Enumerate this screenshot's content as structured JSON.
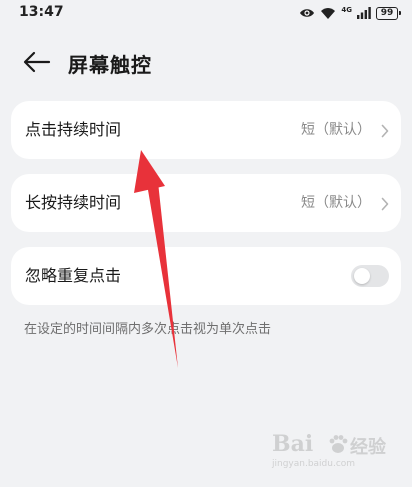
{
  "status_bar": {
    "time": "13:47",
    "network_label": "4G",
    "battery_level": "99"
  },
  "header": {
    "title": "屏幕触控"
  },
  "settings": [
    {
      "label": "点击持续时间",
      "value": "短（默认）"
    },
    {
      "label": "长按持续时间",
      "value": "短（默认）"
    },
    {
      "label": "忽略重复点击",
      "toggle_on": false
    }
  ],
  "hint": "在设定的时间间隔内多次点击视为单次点击",
  "watermark": {
    "brand": "Bai",
    "brand_cn": "经验",
    "url": "jingyan.baidu.com"
  },
  "colors": {
    "background": "#f1f2f4",
    "card": "#ffffff",
    "annotation_arrow": "#e8323a"
  }
}
